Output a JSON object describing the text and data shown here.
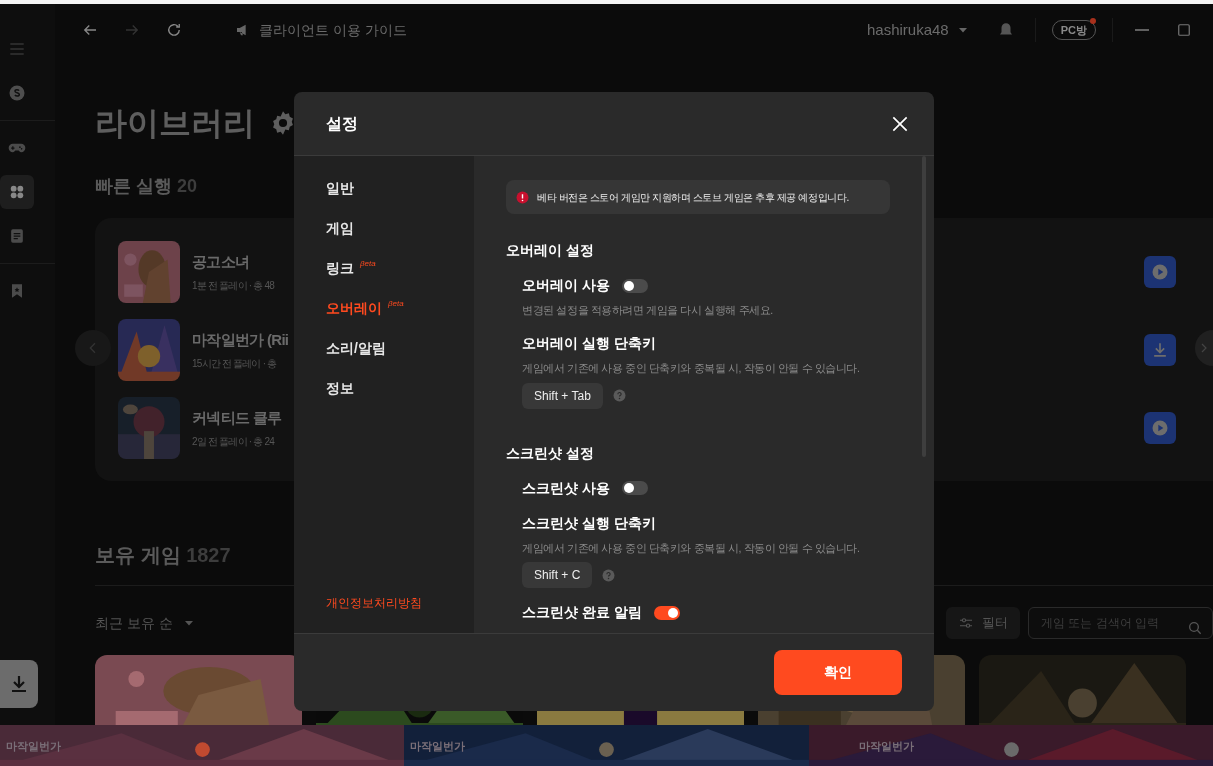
{
  "topbar": {
    "guide": "클라이언트 이용 가이드",
    "user": "hashiruka48",
    "pc_badge": "PC방"
  },
  "sidebar": {
    "items": [
      {
        "kind": "menu",
        "selected": false
      },
      {
        "kind": "coin",
        "selected": false
      },
      {
        "kind": "gamepad",
        "selected": false
      },
      {
        "kind": "apps",
        "selected": true
      },
      {
        "kind": "notes",
        "selected": false
      },
      {
        "kind": "bookmark",
        "selected": false
      }
    ]
  },
  "library": {
    "title": "라이브러리",
    "quick": {
      "title": "빠른 실행",
      "count": "20",
      "games": [
        {
          "name": "공고소녀",
          "meta": "1분 전 플레이 · 총 48",
          "kind": "play"
        },
        {
          "name": "마작일번가 (Rii",
          "meta": "15시간 전 플레이 · 총",
          "kind": "download"
        },
        {
          "name": "커넥티드 클루",
          "meta": "2일 전 플레이 · 총 24",
          "kind": "play"
        }
      ]
    },
    "owned": {
      "title": "보유 게임",
      "count": "1827",
      "sort": "최근 보유 순",
      "filter": "필터",
      "search_placeholder": "게임 또는 검색어 입력"
    }
  },
  "banners": [
    {
      "label": "마작일번가"
    },
    {
      "label": "마작일번가"
    },
    {
      "label": "마작일번가"
    }
  ],
  "settings_dialog": {
    "title": "설정",
    "nav": [
      {
        "label": "일반",
        "selected": false
      },
      {
        "label": "게임",
        "selected": false
      },
      {
        "label": "링크",
        "beta": "βeta",
        "selected": false
      },
      {
        "label": "오버레이",
        "beta": "βeta",
        "selected": true
      },
      {
        "label": "소리/알림",
        "selected": false
      },
      {
        "label": "정보",
        "selected": false
      }
    ],
    "privacy_link": "개인정보처리방침",
    "notice": "베타 버전은 스토어 게임만 지원하며 스토브 게임은 추후 제공 예정입니다.",
    "sections": [
      {
        "title": "오버레이 설정",
        "items": [
          {
            "kind": "toggle",
            "label": "오버레이 사용",
            "on": false,
            "hint": "변경된 설정을 적용하려면 게임을 다시 실행해 주세요."
          },
          {
            "kind": "shortcut",
            "label": "오버레이 실행 단축키",
            "hint": "게임에서 기존에 사용 중인 단축키와 중복될 시, 작동이 안될 수 있습니다.",
            "key": "Shift + Tab"
          }
        ]
      },
      {
        "title": "스크린샷 설정",
        "items": [
          {
            "kind": "toggle",
            "label": "스크린샷 사용",
            "on": false
          },
          {
            "kind": "shortcut",
            "label": "스크린샷 실행 단축키",
            "hint": "게임에서 기존에 사용 중인 단축키와 중복될 시, 작동이 안될 수 있습니다.",
            "key": "Shift + C"
          },
          {
            "kind": "toggle",
            "label": "스크린샷 완료 알림",
            "on": true
          }
        ]
      }
    ],
    "confirm": "확인"
  }
}
